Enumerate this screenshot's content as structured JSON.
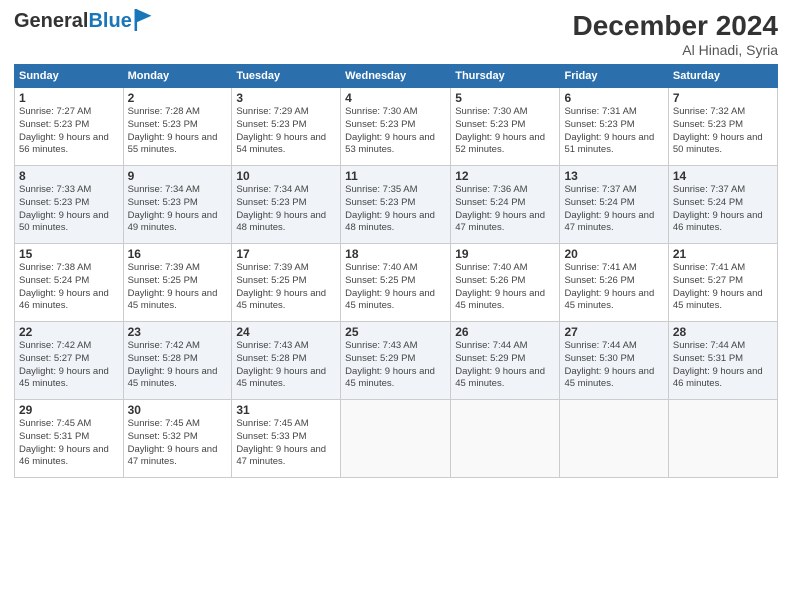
{
  "header": {
    "logo_general": "General",
    "logo_blue": "Blue",
    "month_title": "December 2024",
    "location": "Al Hinadi, Syria"
  },
  "calendar": {
    "days_of_week": [
      "Sunday",
      "Monday",
      "Tuesday",
      "Wednesday",
      "Thursday",
      "Friday",
      "Saturday"
    ],
    "weeks": [
      [
        null,
        {
          "day": 2,
          "sunrise": "7:28 AM",
          "sunset": "5:23 PM",
          "daylight": "9 hours and 55 minutes."
        },
        {
          "day": 3,
          "sunrise": "7:29 AM",
          "sunset": "5:23 PM",
          "daylight": "9 hours and 54 minutes."
        },
        {
          "day": 4,
          "sunrise": "7:30 AM",
          "sunset": "5:23 PM",
          "daylight": "9 hours and 53 minutes."
        },
        {
          "day": 5,
          "sunrise": "7:30 AM",
          "sunset": "5:23 PM",
          "daylight": "9 hours and 52 minutes."
        },
        {
          "day": 6,
          "sunrise": "7:31 AM",
          "sunset": "5:23 PM",
          "daylight": "9 hours and 51 minutes."
        },
        {
          "day": 7,
          "sunrise": "7:32 AM",
          "sunset": "5:23 PM",
          "daylight": "9 hours and 50 minutes."
        }
      ],
      [
        {
          "day": 8,
          "sunrise": "7:33 AM",
          "sunset": "5:23 PM",
          "daylight": "9 hours and 50 minutes."
        },
        {
          "day": 9,
          "sunrise": "7:34 AM",
          "sunset": "5:23 PM",
          "daylight": "9 hours and 49 minutes."
        },
        {
          "day": 10,
          "sunrise": "7:34 AM",
          "sunset": "5:23 PM",
          "daylight": "9 hours and 48 minutes."
        },
        {
          "day": 11,
          "sunrise": "7:35 AM",
          "sunset": "5:23 PM",
          "daylight": "9 hours and 48 minutes."
        },
        {
          "day": 12,
          "sunrise": "7:36 AM",
          "sunset": "5:24 PM",
          "daylight": "9 hours and 47 minutes."
        },
        {
          "day": 13,
          "sunrise": "7:37 AM",
          "sunset": "5:24 PM",
          "daylight": "9 hours and 47 minutes."
        },
        {
          "day": 14,
          "sunrise": "7:37 AM",
          "sunset": "5:24 PM",
          "daylight": "9 hours and 46 minutes."
        }
      ],
      [
        {
          "day": 15,
          "sunrise": "7:38 AM",
          "sunset": "5:24 PM",
          "daylight": "9 hours and 46 minutes."
        },
        {
          "day": 16,
          "sunrise": "7:39 AM",
          "sunset": "5:25 PM",
          "daylight": "9 hours and 45 minutes."
        },
        {
          "day": 17,
          "sunrise": "7:39 AM",
          "sunset": "5:25 PM",
          "daylight": "9 hours and 45 minutes."
        },
        {
          "day": 18,
          "sunrise": "7:40 AM",
          "sunset": "5:25 PM",
          "daylight": "9 hours and 45 minutes."
        },
        {
          "day": 19,
          "sunrise": "7:40 AM",
          "sunset": "5:26 PM",
          "daylight": "9 hours and 45 minutes."
        },
        {
          "day": 20,
          "sunrise": "7:41 AM",
          "sunset": "5:26 PM",
          "daylight": "9 hours and 45 minutes."
        },
        {
          "day": 21,
          "sunrise": "7:41 AM",
          "sunset": "5:27 PM",
          "daylight": "9 hours and 45 minutes."
        }
      ],
      [
        {
          "day": 22,
          "sunrise": "7:42 AM",
          "sunset": "5:27 PM",
          "daylight": "9 hours and 45 minutes."
        },
        {
          "day": 23,
          "sunrise": "7:42 AM",
          "sunset": "5:28 PM",
          "daylight": "9 hours and 45 minutes."
        },
        {
          "day": 24,
          "sunrise": "7:43 AM",
          "sunset": "5:28 PM",
          "daylight": "9 hours and 45 minutes."
        },
        {
          "day": 25,
          "sunrise": "7:43 AM",
          "sunset": "5:29 PM",
          "daylight": "9 hours and 45 minutes."
        },
        {
          "day": 26,
          "sunrise": "7:44 AM",
          "sunset": "5:29 PM",
          "daylight": "9 hours and 45 minutes."
        },
        {
          "day": 27,
          "sunrise": "7:44 AM",
          "sunset": "5:30 PM",
          "daylight": "9 hours and 45 minutes."
        },
        {
          "day": 28,
          "sunrise": "7:44 AM",
          "sunset": "5:31 PM",
          "daylight": "9 hours and 46 minutes."
        }
      ],
      [
        {
          "day": 29,
          "sunrise": "7:45 AM",
          "sunset": "5:31 PM",
          "daylight": "9 hours and 46 minutes."
        },
        {
          "day": 30,
          "sunrise": "7:45 AM",
          "sunset": "5:32 PM",
          "daylight": "9 hours and 47 minutes."
        },
        {
          "day": 31,
          "sunrise": "7:45 AM",
          "sunset": "5:33 PM",
          "daylight": "9 hours and 47 minutes."
        },
        null,
        null,
        null,
        null
      ]
    ],
    "week1_sunday": {
      "day": 1,
      "sunrise": "7:27 AM",
      "sunset": "5:23 PM",
      "daylight": "9 hours and 56 minutes."
    }
  }
}
